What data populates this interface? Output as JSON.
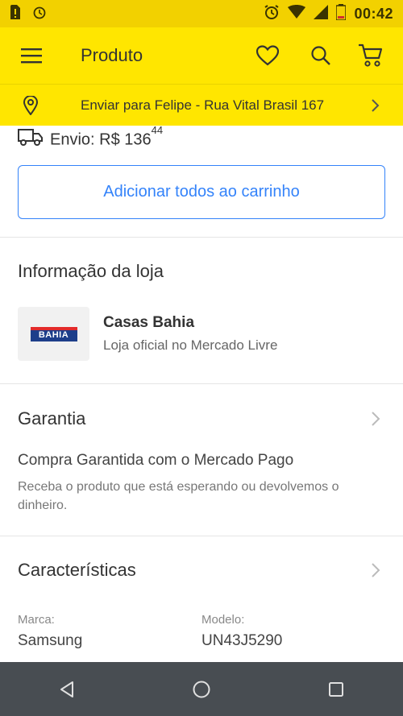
{
  "status_bar": {
    "time": "00:42",
    "icons": [
      "sim-alert-icon",
      "alarm-icon",
      "alarm-clock-icon",
      "wifi-icon",
      "signal-icon",
      "battery-low-icon"
    ]
  },
  "app_bar": {
    "title": "Produto",
    "icons": [
      "menu-icon",
      "heart-icon",
      "search-icon",
      "cart-icon"
    ]
  },
  "shipping_bar": {
    "text": "Enviar para Felipe - Rua Vital Brasil 167"
  },
  "envio": {
    "label": "Envio: R$ 136",
    "cents": "44"
  },
  "add_all_button": {
    "label": "Adicionar todos ao carrinho"
  },
  "store_info": {
    "title": "Informação da loja",
    "name": "Casas Bahia",
    "subtitle": "Loja oficial no Mercado Livre",
    "logo_text": "BAHIA"
  },
  "warranty": {
    "title": "Garantia",
    "main": "Compra Garantida com o Mercado Pago",
    "sub": "Receba o produto que está esperando ou devolvemos o dinheiro."
  },
  "specs": {
    "title": "Características",
    "items": [
      {
        "label": "Marca:",
        "value": "Samsung"
      },
      {
        "label": "Modelo:",
        "value": "UN43J5290"
      }
    ]
  },
  "colors": {
    "yellow": "#ffe600",
    "status_yellow": "#f2d100",
    "blue": "#3483fa",
    "nav_gray": "#484d52"
  }
}
